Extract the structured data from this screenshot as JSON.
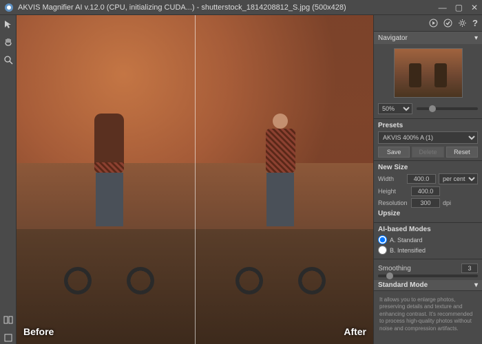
{
  "titlebar": {
    "title": "AKVIS Magnifier AI v.12.0 (CPU, initializing CUDA...) - shutterstock_1814208812_S.jpg (500x428)"
  },
  "canvas": {
    "before_label": "Before",
    "after_label": "After"
  },
  "navigator": {
    "title": "Navigator",
    "zoom": "50%"
  },
  "presets": {
    "title": "Presets",
    "selected": "AKVIS 400% A (1)",
    "save": "Save",
    "delete": "Delete",
    "reset": "Reset"
  },
  "newsize": {
    "title": "New Size",
    "width_label": "Width",
    "width_val": "400.0",
    "height_label": "Height",
    "height_val": "400.0",
    "unit": "per cent",
    "res_label": "Resolution",
    "res_val": "300",
    "res_unit": "dpi",
    "upsize": "Upsize"
  },
  "ai_modes": {
    "title": "AI-based Modes",
    "opt_a": "A. Standard",
    "opt_b": "B. Intensified"
  },
  "smoothing": {
    "label": "Smoothing",
    "value": "3"
  },
  "standard_mode": {
    "title": "Standard Mode",
    "desc": "It allows you to enlarge photos, preserving details and texture and enhancing contrast. It's recommended to process high-quality photos without noise and compression artifacts."
  }
}
